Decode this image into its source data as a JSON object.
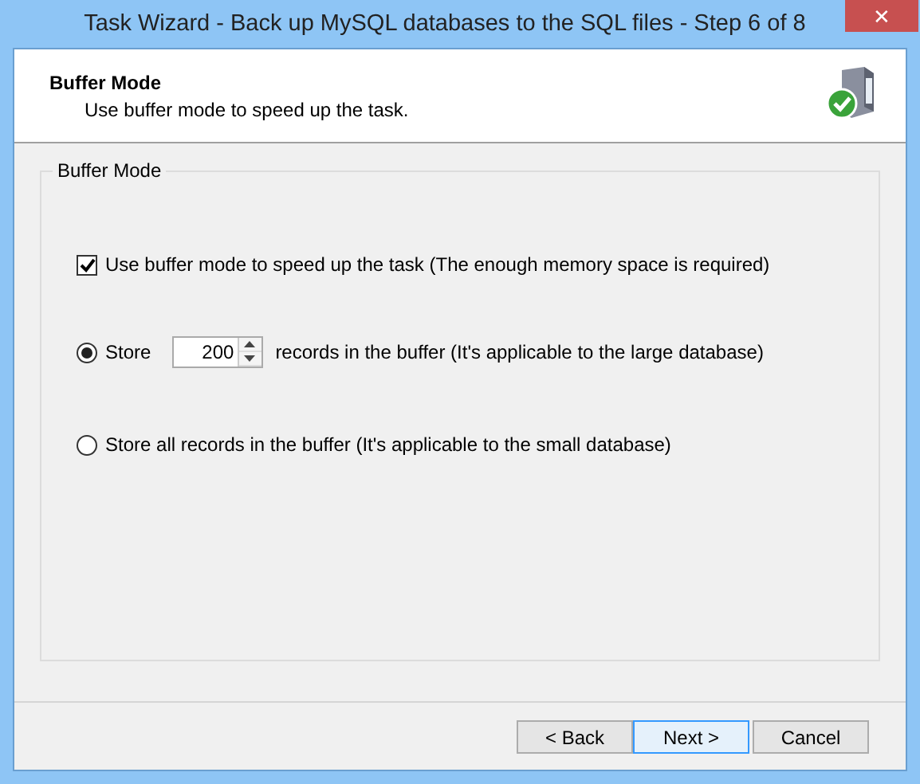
{
  "window": {
    "title": "Task Wizard - Back up MySQL databases to the SQL files - Step 6 of 8",
    "close": "✕"
  },
  "header": {
    "title": "Buffer Mode",
    "subtitle": "Use buffer mode to speed up the task."
  },
  "group": {
    "title": "Buffer Mode",
    "checkbox": {
      "label": "Use buffer mode to speed up the task (The enough memory space is required)",
      "checked": true
    },
    "options": [
      {
        "kind": "spin",
        "label": "Store",
        "value": "200",
        "suffix": "records in the buffer (It's applicable to the large database)",
        "selected": true
      },
      {
        "kind": "plain",
        "label": "Store all records in the buffer (It's applicable to the small database)",
        "selected": false
      }
    ]
  },
  "buttons": [
    {
      "label": "< Back",
      "default": false
    },
    {
      "label": "Next >",
      "default": true
    },
    {
      "label": "Cancel",
      "default": false
    }
  ]
}
